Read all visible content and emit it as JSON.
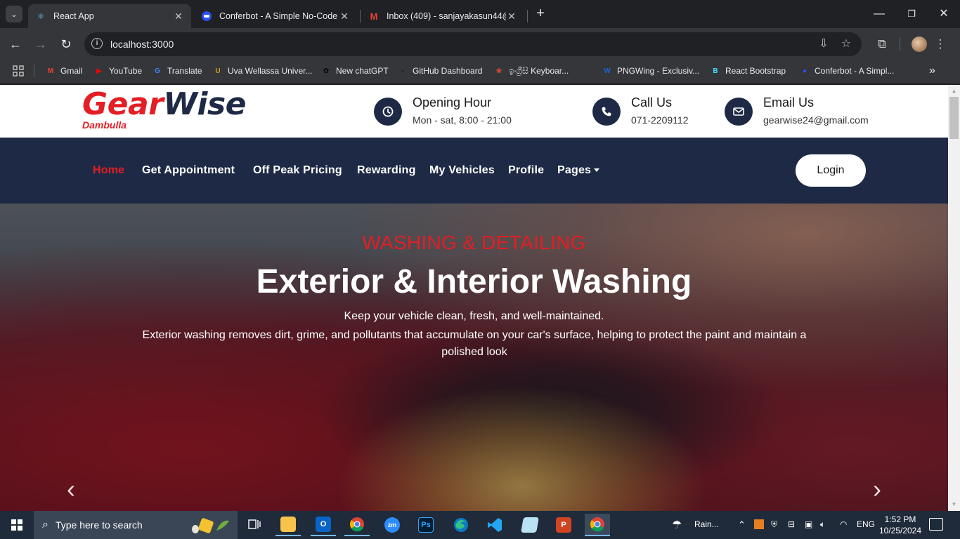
{
  "browser": {
    "tabs": [
      {
        "title": "React App",
        "active": true
      },
      {
        "title": "Conferbot - A Simple No-Code",
        "active": false
      },
      {
        "title": "Inbox (409) - sanjayakasun44@",
        "active": false
      }
    ],
    "window_controls": {
      "minimize": "—",
      "maximize": "❐",
      "close": "✕"
    },
    "url": "localhost:3000",
    "bookmarks": [
      {
        "label": "Gmail",
        "icon": "gmail-icon",
        "glyph": "M",
        "color": "#ea4335"
      },
      {
        "label": "YouTube",
        "icon": "youtube-icon",
        "glyph": "▶",
        "color": "#ff0000"
      },
      {
        "label": "Translate",
        "icon": "translate-icon",
        "glyph": "G",
        "color": "#4285f4"
      },
      {
        "label": "Uva Wellassa Univer...",
        "icon": "university-icon",
        "glyph": "U",
        "color": "#c9a227"
      },
      {
        "label": "New chatGPT",
        "icon": "chatgpt-icon",
        "glyph": "✿",
        "color": "#000000"
      },
      {
        "label": "GitHub Dashboard",
        "icon": "github-icon",
        "glyph": "●",
        "color": "#24292e"
      },
      {
        "label": "ඉංග්‍රීසි Keyboar...",
        "icon": "keyboard-icon",
        "glyph": "❀",
        "color": "#e84c3d"
      },
      {
        "label": "PNGWing - Exclusiv...",
        "icon": "pngwing-icon",
        "glyph": "W",
        "color": "#1e63d6"
      },
      {
        "label": "React Bootstrap",
        "icon": "react-bootstrap-icon",
        "glyph": "B",
        "color": "#41e0fd"
      },
      {
        "label": "Conferbot - A Simpl...",
        "icon": "conferbot-icon",
        "glyph": "●",
        "color": "#2b50ed"
      }
    ]
  },
  "site": {
    "logo": {
      "part1": "Gear",
      "part2": "Wise",
      "sub": "Dambulla"
    },
    "contacts": [
      {
        "title": "Opening Hour",
        "value": "Mon - sat, 8:00 - 21:00",
        "icon": "clock-icon"
      },
      {
        "title": "Call Us",
        "value": "071-2209112",
        "icon": "phone-icon"
      },
      {
        "title": "Email Us",
        "value": "gearwise24@gmail.com",
        "icon": "envelope-icon"
      }
    ],
    "nav": [
      {
        "label": "Home",
        "active": true
      },
      {
        "label": "Get Appointment",
        "active": false
      },
      {
        "label": "Off Peak Pricing",
        "active": false
      },
      {
        "label": "Rewarding",
        "active": false
      },
      {
        "label": "My Vehicles",
        "active": false
      },
      {
        "label": "Profile",
        "active": false
      },
      {
        "label": "Pages",
        "active": false
      }
    ],
    "login": "Login",
    "hero": {
      "kicker": "WASHING & DETAILING",
      "title": "Exterior & Interior Washing",
      "lead": "Keep your vehicle clean, fresh, and well-maintained.",
      "body": "Exterior washing removes dirt, grime, and pollutants that accumulate on your car's surface, helping to protect the paint and maintain a polished look"
    },
    "colors": {
      "accent": "#e31e24",
      "navy": "#1e2a45"
    }
  },
  "taskbar": {
    "search_placeholder": "Type here to search",
    "weather": "Rain...",
    "lang": "ENG",
    "time": "1:52 PM",
    "date": "10/25/2024"
  }
}
